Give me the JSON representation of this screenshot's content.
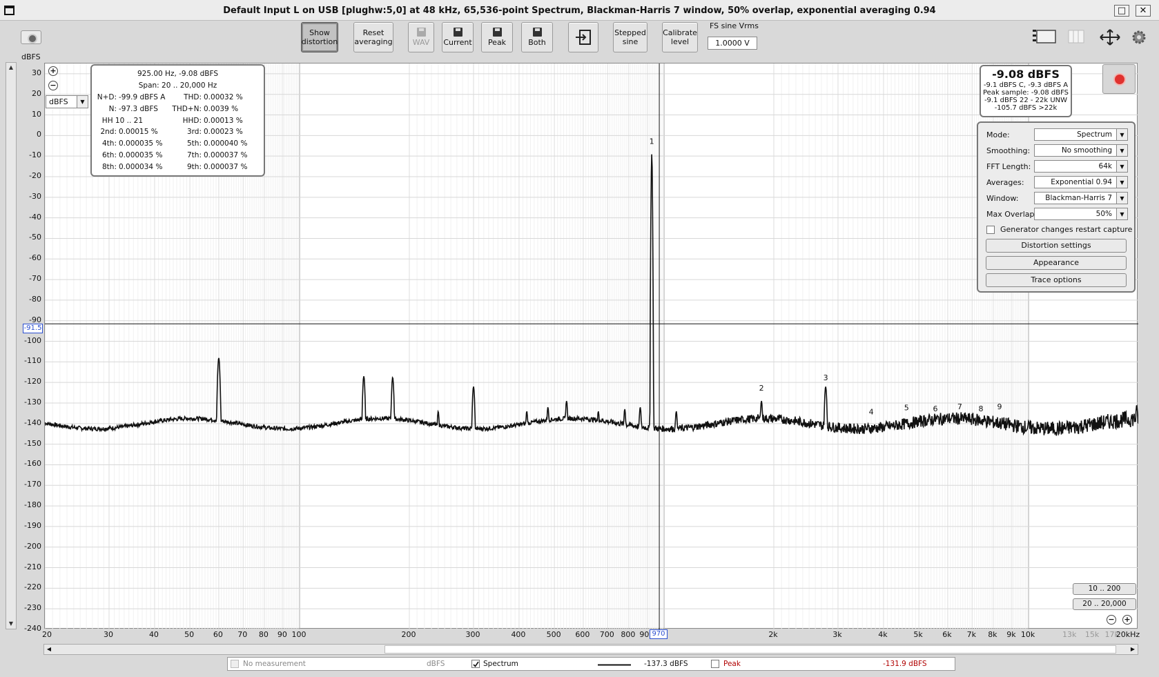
{
  "window": {
    "title": "Default Input L on USB [plughw:5,0] at 48 kHz, 65,536-point Spectrum, Blackman-Harris 7 window, 50% overlap, exponential averaging 0.94",
    "maximize_glyph": "□",
    "close_glyph": "✕"
  },
  "toolbar": {
    "show_distortion": "Show distortion",
    "reset_averaging": "Reset averaging",
    "wav": "WAV",
    "current": "Current",
    "peak": "Peak",
    "both": "Both",
    "stepped_sine": "Stepped sine",
    "calibrate_level": "Calibrate level",
    "fs_label": "FS sine Vrms",
    "fs_value": "1.0000 V"
  },
  "left": {
    "unit_label": "dBFS",
    "unit_select": "dBFS",
    "dropdown_glyph": "▼"
  },
  "zoom": {
    "in": "+",
    "out": "−"
  },
  "cursor": {
    "y_value": "-91.5",
    "x_value": "970"
  },
  "distortion": {
    "header1": "925.00 Hz, -9.08 dBFS",
    "header2": "Span: 20 .. 20,000 Hz",
    "rows": [
      {
        "l1": "N+D:",
        "v1": "-99.9 dBFS A",
        "l2": "THD:",
        "v2": "0.00032 %"
      },
      {
        "l1": "N:",
        "v1": "-97.3 dBFS",
        "l2": "THD+N:",
        "v2": "0.0039 %"
      },
      {
        "l1": "HH 10 .. 21",
        "v1": "",
        "l2": "HHD:",
        "v2": "0.00013 %"
      },
      {
        "l1": "2nd:",
        "v1": "0.00015 %",
        "l2": "3rd:",
        "v2": "0.00023 %"
      },
      {
        "l1": "4th:",
        "v1": "0.000035 %",
        "l2": "5th:",
        "v2": "0.000040 %"
      },
      {
        "l1": "6th:",
        "v1": "0.000035 %",
        "l2": "7th:",
        "v2": "0.000037 %"
      },
      {
        "l1": "8th:",
        "v1": "0.000034 %",
        "l2": "9th:",
        "v2": "0.000037 %"
      }
    ]
  },
  "level": {
    "main": "-9.08 dBFS",
    "l1": "-9.1 dBFS C, -9.3 dBFS A",
    "l2": "Peak sample: -9.08 dBFS",
    "l3": "-9.1 dBFS 22 - 22k UNW",
    "l4": "-105.7 dBFS >22k"
  },
  "controls": {
    "mode_label": "Mode:",
    "mode_value": "Spectrum",
    "smoothing_label": "Smoothing:",
    "smoothing_value": "No  smoothing",
    "fft_label": "FFT Length:",
    "fft_value": "64k",
    "averages_label": "Averages:",
    "averages_value": "Exponential 0.94",
    "window_label": "Window:",
    "window_value": "Blackman-Harris 7",
    "overlap_label": "Max Overlap:",
    "overlap_value": "50%",
    "restart_label": "Generator changes restart capture",
    "distortion_settings": "Distortion settings",
    "appearance": "Appearance",
    "trace_options": "Trace options"
  },
  "range_buttons": {
    "r1": "10 .. 200",
    "r2": "20 .. 20,000"
  },
  "legend": {
    "no_measurement": "No measurement",
    "no_measurement_unit": "dBFS",
    "spectrum": "Spectrum",
    "spectrum_value": "-137.3 dBFS",
    "peak": "Peak",
    "peak_value": "-131.9 dBFS"
  },
  "chart_data": {
    "type": "line",
    "ylabel": "dBFS",
    "x_scale": "log",
    "xlim": [
      20,
      20000
    ],
    "ylim": [
      -240,
      35
    ],
    "grid": true,
    "y_ticks": [
      "30",
      "20",
      "10",
      "0",
      "-10",
      "-20",
      "-30",
      "-40",
      "-50",
      "-60",
      "-70",
      "-80",
      "-90",
      "-100",
      "-110",
      "-120",
      "-130",
      "-140",
      "-150",
      "-160",
      "-170",
      "-180",
      "-190",
      "-200",
      "-210",
      "-220",
      "-230",
      "-240"
    ],
    "x_ticks": [
      {
        "f": 20,
        "label": "20"
      },
      {
        "f": 30,
        "label": "30"
      },
      {
        "f": 40,
        "label": "40"
      },
      {
        "f": 50,
        "label": "50"
      },
      {
        "f": 60,
        "label": "60"
      },
      {
        "f": 70,
        "label": "70"
      },
      {
        "f": 80,
        "label": "80"
      },
      {
        "f": 90,
        "label": "90"
      },
      {
        "f": 100,
        "label": "100"
      },
      {
        "f": 200,
        "label": "200"
      },
      {
        "f": 300,
        "label": "300"
      },
      {
        "f": 400,
        "label": "400"
      },
      {
        "f": 500,
        "label": "500"
      },
      {
        "f": 600,
        "label": "600"
      },
      {
        "f": 700,
        "label": "700"
      },
      {
        "f": 800,
        "label": "800"
      },
      {
        "f": 900,
        "label": "900"
      },
      {
        "f": 2000,
        "label": "2k"
      },
      {
        "f": 3000,
        "label": "3k"
      },
      {
        "f": 4000,
        "label": "4k"
      },
      {
        "f": 5000,
        "label": "5k"
      },
      {
        "f": 6000,
        "label": "6k"
      },
      {
        "f": 7000,
        "label": "7k"
      },
      {
        "f": 8000,
        "label": "8k"
      },
      {
        "f": 9000,
        "label": "9k"
      },
      {
        "f": 10000,
        "label": "10k"
      },
      {
        "f": 13000,
        "label": "13k",
        "grey": true
      },
      {
        "f": 15000,
        "label": "15k",
        "grey": true
      },
      {
        "f": 17000,
        "label": "17k",
        "grey": true
      },
      {
        "f": 20000,
        "label": "20kHz"
      }
    ],
    "noise_floor": -140,
    "cursor": {
      "f": 970,
      "db": -91.5
    },
    "series": [
      {
        "name": "Spectrum",
        "peaks": [
          {
            "f": 60,
            "db": -108
          },
          {
            "f": 150,
            "db": -117
          },
          {
            "f": 180,
            "db": -117.5
          },
          {
            "f": 240,
            "db": -134
          },
          {
            "f": 300,
            "db": -122
          },
          {
            "f": 420,
            "db": -134
          },
          {
            "f": 480,
            "db": -132
          },
          {
            "f": 540,
            "db": -129
          },
          {
            "f": 660,
            "db": -134
          },
          {
            "f": 780,
            "db": -133
          },
          {
            "f": 860,
            "db": -132
          },
          {
            "f": 925,
            "db": -9.08
          },
          {
            "f": 1080,
            "db": -134
          },
          {
            "f": 1850,
            "db": -129
          },
          {
            "f": 2775,
            "db": -122
          },
          {
            "f": 19800,
            "db": -131
          }
        ]
      }
    ],
    "harmonic_markers": [
      {
        "label": "1",
        "f": 925,
        "db": -4
      },
      {
        "label": "2",
        "f": 1850,
        "db": -124
      },
      {
        "label": "3",
        "f": 2775,
        "db": -119
      },
      {
        "label": "4",
        "f": 3700,
        "db": -135.5
      },
      {
        "label": "5",
        "f": 4625,
        "db": -133.5
      },
      {
        "label": "6",
        "f": 5550,
        "db": -134
      },
      {
        "label": "7",
        "f": 6475,
        "db": -133
      },
      {
        "label": "8",
        "f": 7400,
        "db": -134
      },
      {
        "label": "9",
        "f": 8325,
        "db": -133
      }
    ]
  }
}
